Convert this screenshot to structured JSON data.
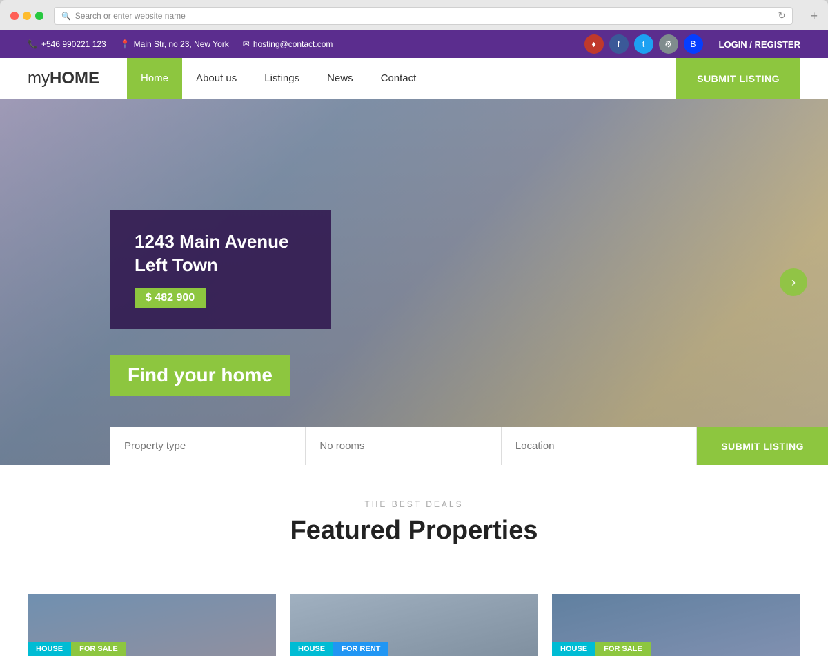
{
  "browser": {
    "address_placeholder": "Search or enter website name",
    "new_tab_label": "+"
  },
  "topbar": {
    "phone": "+546 990221 123",
    "address": "Main Str, no 23, New York",
    "email": "hosting@contact.com",
    "login_register": "LOGIN / REGISTER",
    "social": [
      {
        "name": "pinterest",
        "icon": "♦"
      },
      {
        "name": "facebook",
        "icon": "f"
      },
      {
        "name": "twitter",
        "icon": "t"
      },
      {
        "name": "settings",
        "icon": "⚙"
      },
      {
        "name": "behance",
        "icon": "B"
      }
    ]
  },
  "navbar": {
    "logo_my": "my",
    "logo_home": "HOME",
    "links": [
      {
        "label": "Home",
        "active": true
      },
      {
        "label": "About us",
        "active": false
      },
      {
        "label": "Listings",
        "active": false
      },
      {
        "label": "News",
        "active": false
      },
      {
        "label": "Contact",
        "active": false
      }
    ],
    "submit_listing": "SUBMIT LISTING"
  },
  "hero": {
    "property_title": "1243 Main Avenue Left Town",
    "property_price": "$ 482 900",
    "find_home": "Find your home",
    "search": {
      "property_type": "Property type",
      "no_rooms": "No rooms",
      "location": "Location",
      "submit": "SUBMIT LISTING"
    },
    "arrow": "›"
  },
  "featured": {
    "subtitle": "THE BEST DEALS",
    "title": "Featured Properties",
    "cards": [
      {
        "type": "HOUSE",
        "badge": "FOR SALE",
        "badge_class": "sale"
      },
      {
        "type": "HOUSE",
        "badge": "FOR RENT",
        "badge_class": "rent"
      },
      {
        "type": "HOUSE",
        "badge": "FOR SALE",
        "badge_class": "sale"
      }
    ]
  }
}
